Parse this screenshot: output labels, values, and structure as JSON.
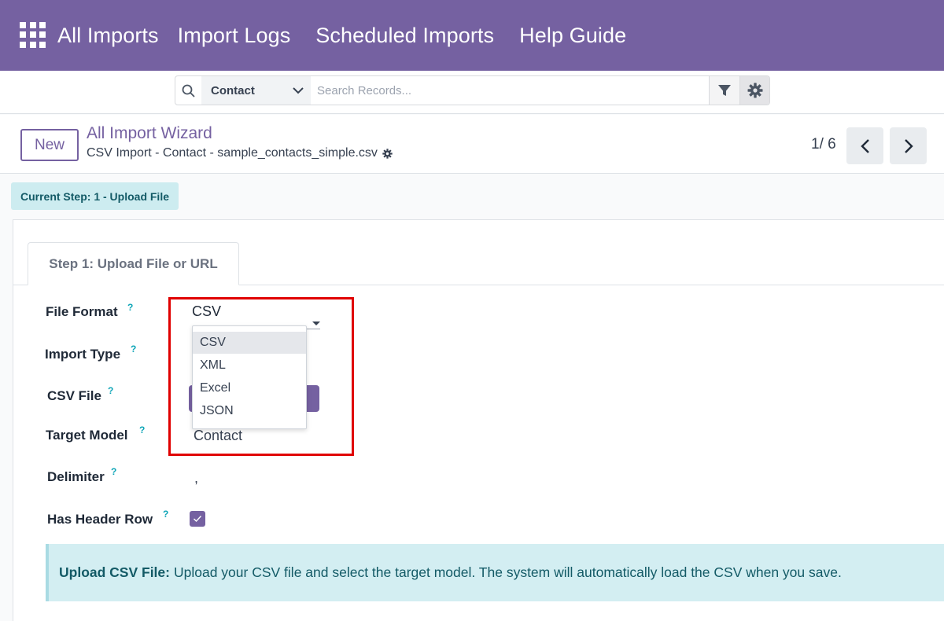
{
  "nav": {
    "items": [
      "All Imports",
      "Import Logs",
      "Scheduled Imports",
      "Help Guide"
    ]
  },
  "search": {
    "model": "Contact",
    "placeholder": "Search Records..."
  },
  "control": {
    "new_label": "New",
    "breadcrumb_title": "All Import Wizard",
    "breadcrumb_sub": "CSV Import - Contact - sample_contacts_simple.csv",
    "pager": "1/ 6"
  },
  "step_badge": "Current Step: 1 - Upload File",
  "tab_label": "Step 1: Upload File or URL",
  "form": {
    "file_format": {
      "label": "File Format",
      "value": "CSV"
    },
    "import_type": {
      "label": "Import Type"
    },
    "csv_file": {
      "label": "CSV File"
    },
    "target_model": {
      "label": "Target Model",
      "value": "Contact"
    },
    "delimiter": {
      "label": "Delimiter",
      "value": ","
    },
    "has_header_row": {
      "label": "Has Header Row",
      "checked": true
    },
    "help_mark": "?"
  },
  "dropdown": {
    "options": [
      "CSV",
      "XML",
      "Excel",
      "JSON"
    ],
    "selected": "CSV"
  },
  "alert": {
    "title": "Upload CSV File:",
    "text": "Upload your CSV file and select the target model. The system will automatically load the CSV when you save."
  },
  "colors": {
    "brand": "#7561a1",
    "info_bg": "#d3eef2",
    "highlight": "#e00000"
  }
}
